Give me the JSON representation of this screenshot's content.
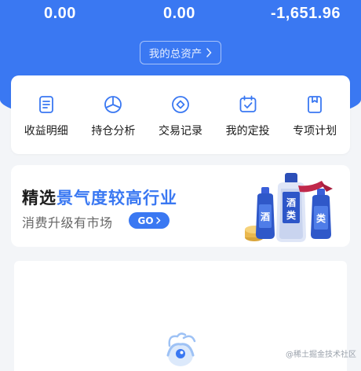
{
  "stats": {
    "value_1": "0.00",
    "value_2": "0.00",
    "value_3": "-1,651.96"
  },
  "total_assets_button": "我的总资产",
  "menu": [
    {
      "label": "收益明细",
      "icon": "document-icon"
    },
    {
      "label": "持仓分析",
      "icon": "pie-chart-icon"
    },
    {
      "label": "交易记录",
      "icon": "diamond-circle-icon"
    },
    {
      "label": "我的定投",
      "icon": "calendar-check-icon"
    },
    {
      "label": "专项计划",
      "icon": "bookmark-icon"
    }
  ],
  "banner": {
    "title_prefix": "精选",
    "title_highlight": "景气度较高行业",
    "subtitle": "消费升级有市场",
    "go_label": "GO",
    "bottle_label_1": "酒",
    "bottle_label_2": "类"
  },
  "watermark": "@稀土掘金技术社区",
  "colors": {
    "primary": "#3a78f2",
    "background": "#f3f5f8",
    "card": "#ffffff"
  }
}
